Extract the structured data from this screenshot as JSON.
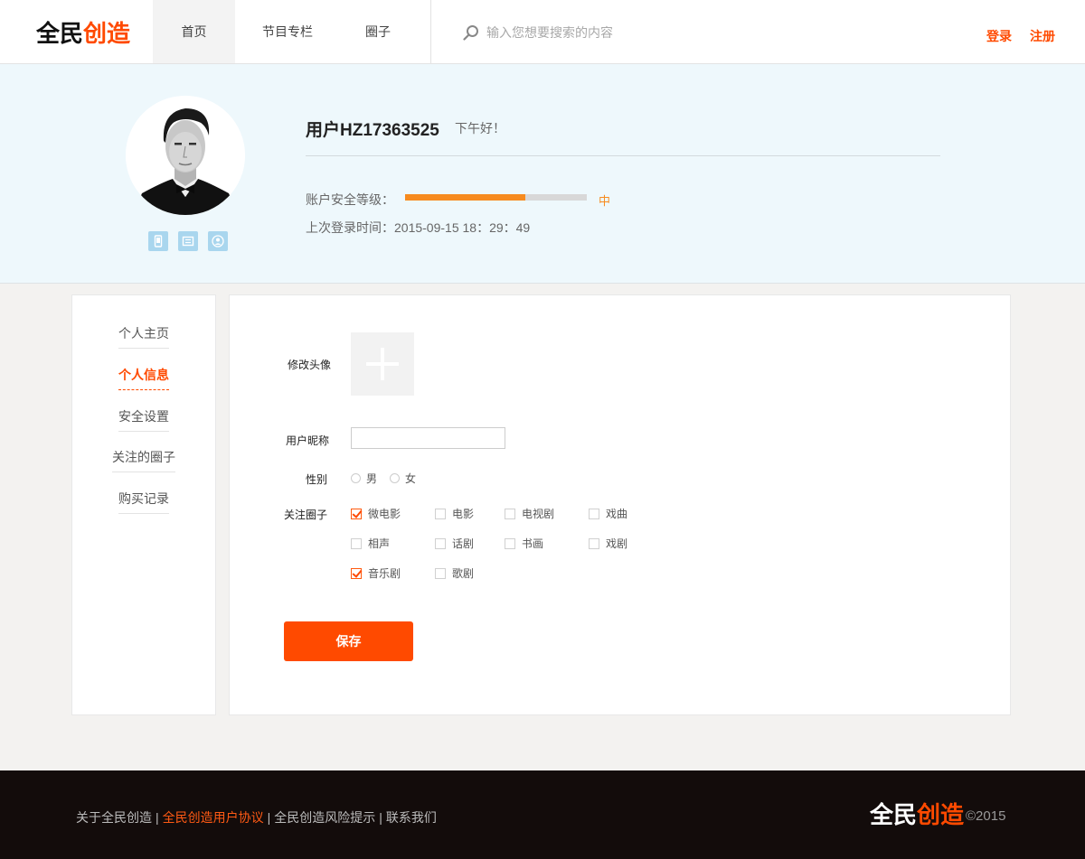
{
  "header": {
    "logo_a": "全民",
    "logo_b": "创造",
    "nav": [
      "首页",
      "节目专栏",
      "圈子"
    ],
    "search_placeholder": "输入您想要搜索的内容",
    "login": "登录",
    "register": "注册"
  },
  "profile": {
    "username": "用户HZ17363525",
    "greeting": "下午好！",
    "security_label": "账户安全等级：",
    "security_level_text": "中",
    "security_level_fraction": 0.66,
    "last_login_label": "上次登录时间：",
    "last_login": "2015-09-15 18：29：49",
    "icons": [
      "phone-icon",
      "message-icon",
      "user-icon"
    ]
  },
  "sidebar": {
    "items": [
      "个人主页",
      "个人信息",
      "安全设置",
      "关注的圈子",
      "购买记录"
    ],
    "active": "个人信息"
  },
  "form": {
    "avatar_label": "修改头像",
    "nickname_label": "用户昵称",
    "nickname_value": "",
    "gender_label": "性别",
    "gender_options": [
      "男",
      "女"
    ],
    "circles_label": "关注圈子",
    "circles": [
      {
        "name": "微电影",
        "checked": true
      },
      {
        "name": "电影",
        "checked": false
      },
      {
        "name": "电视剧",
        "checked": false
      },
      {
        "name": "戏曲",
        "checked": false
      },
      {
        "name": "相声",
        "checked": false
      },
      {
        "name": "话剧",
        "checked": false
      },
      {
        "name": "书画",
        "checked": false
      },
      {
        "name": "戏剧",
        "checked": false
      },
      {
        "name": "音乐剧",
        "checked": true
      },
      {
        "name": "歌剧",
        "checked": false
      }
    ],
    "save_label": "保存"
  },
  "footer": {
    "links": [
      "关于全民创造",
      "全民创造用户协议",
      "全民创造风险提示",
      "联系我们"
    ],
    "highlight_color": "#ff5a14",
    "logo_a": "全民",
    "logo_b": "创造",
    "copyright": "©2015"
  },
  "colors": {
    "accent": "#ff4a00",
    "security_bar": "#f78b1f",
    "banner_bg": "#eef8fc"
  }
}
